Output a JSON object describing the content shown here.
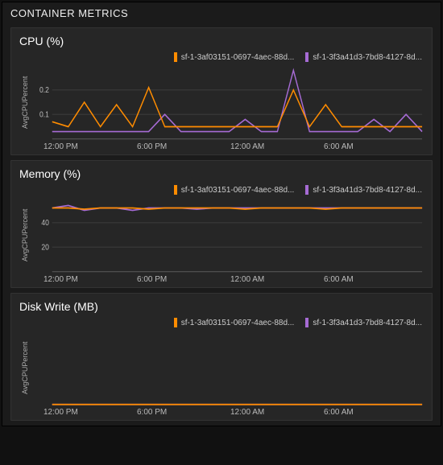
{
  "panel": {
    "title": "CONTAINER METRICS"
  },
  "colors": {
    "orange": "#ff8c00",
    "purple": "#a66bd4"
  },
  "legend": {
    "series1": "sf-1-3af03151-0697-4aec-88d...",
    "series2": "sf-1-3f3a41d3-7bd8-4127-8d..."
  },
  "xticks": [
    "12:00 PM",
    "6:00 PM",
    "12:00 AM",
    "6:00 AM"
  ],
  "charts": [
    {
      "key": "cpu",
      "title": "CPU (%)",
      "ylabel": "AvgCPUPercent"
    },
    {
      "key": "mem",
      "title": "Memory (%)",
      "ylabel": "AvgCPUPercent"
    },
    {
      "key": "disk",
      "title": "Disk Write (MB)",
      "ylabel": "AvgCPUPercent"
    }
  ],
  "chart_data": [
    {
      "type": "line",
      "title": "CPU (%)",
      "xlabel": "",
      "ylabel": "AvgCPUPercent",
      "xticks": [
        "12:00 PM",
        "6:00 PM",
        "12:00 AM",
        "6:00 AM"
      ],
      "yticks": [
        0.1,
        0.2
      ],
      "ylim": [
        0,
        0.3
      ],
      "x": [
        0,
        1,
        2,
        3,
        4,
        5,
        6,
        7,
        8,
        9,
        10,
        11,
        12,
        13,
        14,
        15,
        16,
        17,
        18,
        19,
        20,
        21,
        22,
        23
      ],
      "series": [
        {
          "name": "sf-1-3af03151-0697-4aec-88d...",
          "color": "#ff8c00",
          "values": [
            0.07,
            0.05,
            0.15,
            0.05,
            0.14,
            0.05,
            0.21,
            0.05,
            0.05,
            0.05,
            0.05,
            0.05,
            0.05,
            0.05,
            0.05,
            0.2,
            0.05,
            0.14,
            0.05,
            0.05,
            0.05,
            0.05,
            0.05,
            0.05
          ]
        },
        {
          "name": "sf-1-3f3a41d3-7bd8-4127-8d...",
          "color": "#a66bd4",
          "values": [
            0.03,
            0.03,
            0.03,
            0.03,
            0.03,
            0.03,
            0.03,
            0.1,
            0.03,
            0.03,
            0.03,
            0.03,
            0.08,
            0.03,
            0.03,
            0.28,
            0.03,
            0.03,
            0.03,
            0.03,
            0.08,
            0.03,
            0.1,
            0.03
          ]
        }
      ]
    },
    {
      "type": "line",
      "title": "Memory (%)",
      "xlabel": "",
      "ylabel": "AvgCPUPercent",
      "xticks": [
        "12:00 PM",
        "6:00 PM",
        "12:00 AM",
        "6:00 AM"
      ],
      "yticks": [
        20,
        40
      ],
      "ylim": [
        0,
        60
      ],
      "x": [
        0,
        1,
        2,
        3,
        4,
        5,
        6,
        7,
        8,
        9,
        10,
        11,
        12,
        13,
        14,
        15,
        16,
        17,
        18,
        19,
        20,
        21,
        22,
        23
      ],
      "series": [
        {
          "name": "sf-1-3af03151-0697-4aec-88d...",
          "color": "#ff8c00",
          "values": [
            52,
            52,
            51,
            52,
            52,
            52,
            51,
            52,
            52,
            52,
            52,
            52,
            51,
            52,
            52,
            52,
            52,
            51,
            52,
            52,
            52,
            52,
            52,
            52
          ]
        },
        {
          "name": "sf-1-3f3a41d3-7bd8-4127-8d...",
          "color": "#a66bd4",
          "values": [
            52,
            54,
            50,
            52,
            52,
            50,
            52,
            52,
            52,
            51,
            52,
            52,
            52,
            52,
            52,
            52,
            52,
            52,
            52,
            52,
            52,
            52,
            52,
            52
          ]
        }
      ]
    },
    {
      "type": "line",
      "title": "Disk Write (MB)",
      "xlabel": "",
      "ylabel": "AvgCPUPercent",
      "xticks": [
        "12:00 PM",
        "6:00 PM",
        "12:00 AM",
        "6:00 AM"
      ],
      "yticks": [],
      "ylim": [
        0,
        1
      ],
      "x": [
        0,
        1,
        2,
        3,
        4,
        5,
        6,
        7,
        8,
        9,
        10,
        11,
        12,
        13,
        14,
        15,
        16,
        17,
        18,
        19,
        20,
        21,
        22,
        23
      ],
      "series": [
        {
          "name": "sf-1-3af03151-0697-4aec-88d...",
          "color": "#ff8c00",
          "values": [
            0,
            0,
            0,
            0,
            0,
            0,
            0,
            0,
            0,
            0,
            0,
            0,
            0,
            0,
            0,
            0,
            0,
            0,
            0,
            0,
            0,
            0,
            0,
            0
          ]
        },
        {
          "name": "sf-1-3f3a41d3-7bd8-4127-8d...",
          "color": "#a66bd4",
          "values": [
            0,
            0,
            0,
            0,
            0,
            0,
            0,
            0,
            0,
            0,
            0,
            0,
            0,
            0,
            0,
            0,
            0,
            0,
            0,
            0,
            0,
            0,
            0,
            0
          ]
        }
      ]
    }
  ]
}
